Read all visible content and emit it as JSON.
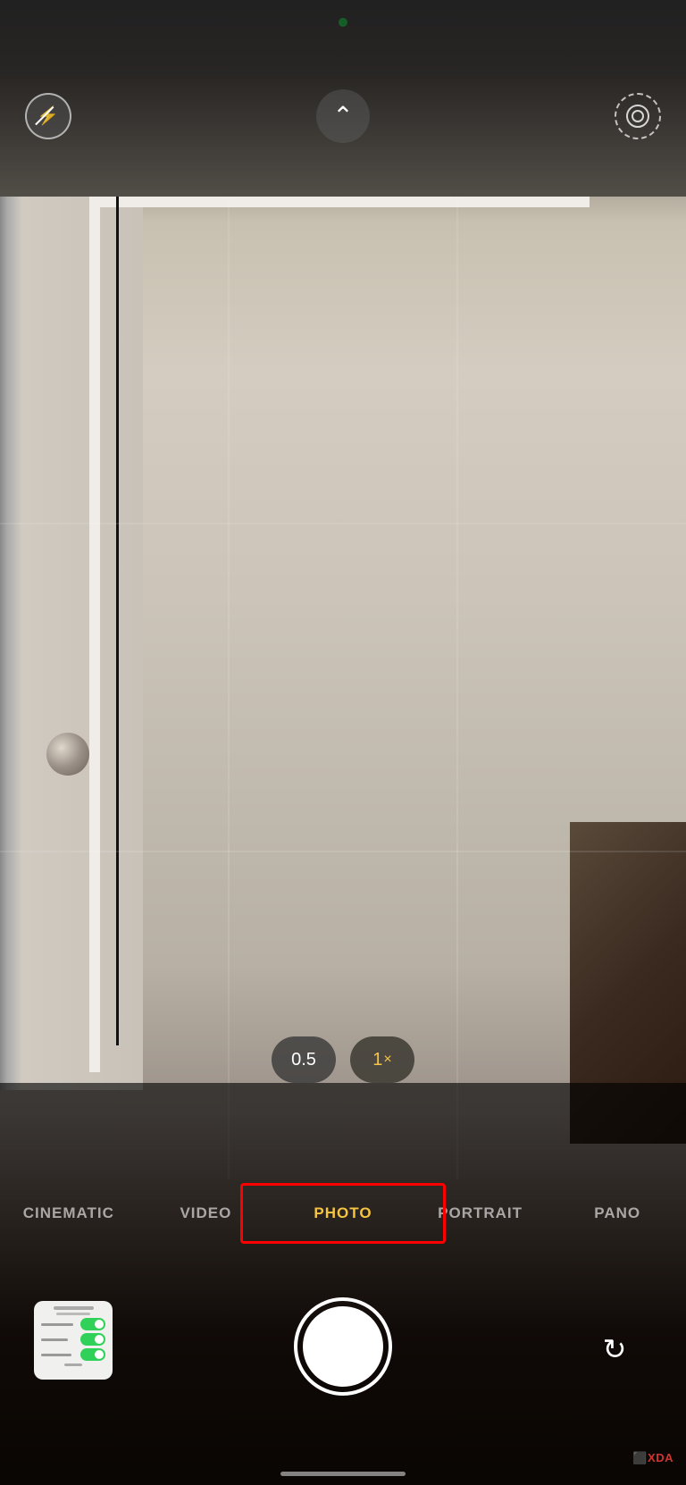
{
  "status_indicator": {
    "color": "#30d158"
  },
  "top_bar": {
    "flash_button_label": "Flash Off",
    "chevron_label": "More Options",
    "live_photo_label": "Live Photo Timer"
  },
  "zoom_controls": {
    "options": [
      {
        "label": "0.5",
        "suffix": "",
        "active": false
      },
      {
        "label": "1",
        "suffix": "×",
        "active": true
      }
    ]
  },
  "mode_selector": {
    "modes": [
      {
        "label": "CINEMATIC",
        "active": false
      },
      {
        "label": "VIDEO",
        "active": false
      },
      {
        "label": "PHOTO",
        "active": true
      },
      {
        "label": "PORTRAIT",
        "active": false
      },
      {
        "label": "PANO",
        "active": false
      }
    ]
  },
  "controls": {
    "shutter_label": "Take Photo",
    "flip_label": "Flip Camera",
    "gallery_label": "Recent Photo"
  },
  "watermark": {
    "text": "⬛XDA"
  },
  "home_indicator": {
    "visible": true
  }
}
